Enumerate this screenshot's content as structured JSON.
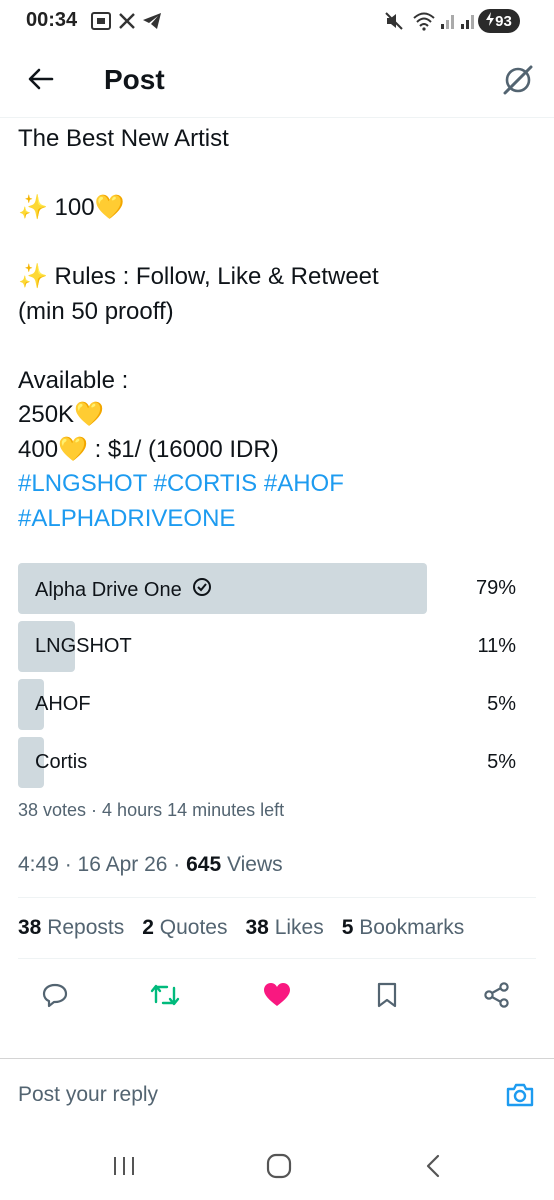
{
  "status_bar": {
    "time": "00:34",
    "battery": "93"
  },
  "header": {
    "title": "Post"
  },
  "post": {
    "line1": "The Best New Artist",
    "line2": "✨ 100💛",
    "line3": "✨ Rules : Follow, Like & Retweet",
    "line4": "(min 50 prooff)",
    "line5": "Available :",
    "line6": "250K💛",
    "line7": "400💛 : $1/ (16000 IDR)",
    "hashtags_line1": "#LNGSHOT #CORTIS #AHOF",
    "hashtags_line2": "#ALPHADRIVEONE"
  },
  "poll": {
    "options": [
      {
        "label": "Alpha Drive One",
        "percent": "79%",
        "value": 79,
        "winner": true
      },
      {
        "label": "LNGSHOT",
        "percent": "11%",
        "value": 11,
        "winner": false
      },
      {
        "label": "AHOF",
        "percent": "5%",
        "value": 5,
        "winner": false
      },
      {
        "label": "Cortis",
        "percent": "5%",
        "value": 5,
        "winner": false
      }
    ],
    "meta": "38 votes · 4 hours 14 minutes left"
  },
  "post_meta": {
    "time_date": "4:49 · 16 Apr 26 · ",
    "views_count": "645",
    "views_label": " Views"
  },
  "stats": {
    "reposts_count": "38",
    "reposts_label": "Reposts",
    "quotes_count": "2",
    "quotes_label": "Quotes",
    "likes_count": "38",
    "likes_label": "Likes",
    "bookmarks_count": "5",
    "bookmarks_label": "Bookmarks"
  },
  "reply": {
    "placeholder": "Post your reply"
  },
  "colors": {
    "accent": "#1d9bf0",
    "repost": "#00ba7c",
    "like": "#f91880",
    "muted": "#536471",
    "poll_bar": "#cfd9de"
  },
  "icons": [
    "arrow-left-icon",
    "grok-icon",
    "comment-icon",
    "repost-icon",
    "heart-icon",
    "bookmark-icon",
    "share-icon",
    "camera-icon",
    "checkmark-circle-icon"
  ]
}
